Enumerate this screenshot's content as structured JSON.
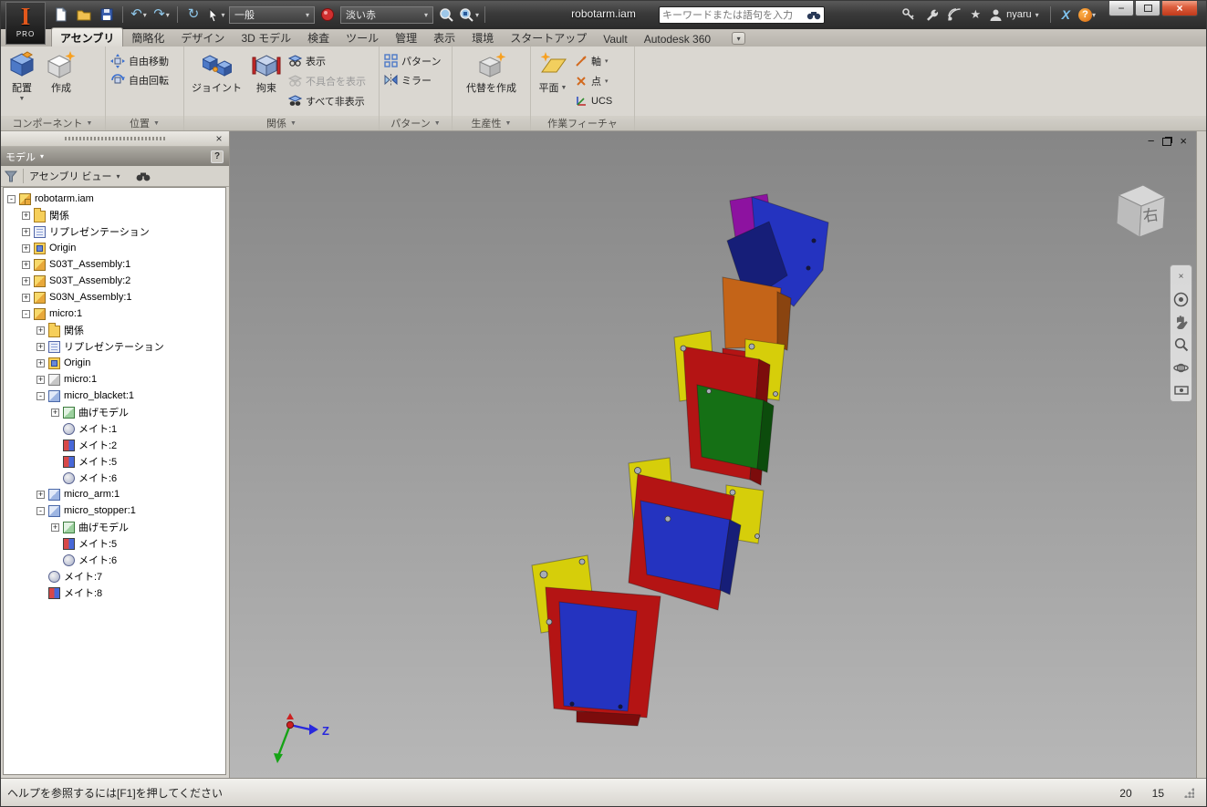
{
  "titlebar": {
    "app_initial": "I",
    "pro_label": "PRO",
    "doc_title": "robotarm.iam",
    "material_style": "一般",
    "appearance_style": "淡い赤",
    "search_placeholder": "キーワードまたは語句を入力",
    "username": "nyaru"
  },
  "icons": {
    "caret_down": "▼",
    "caret_small": "▾",
    "close": "×",
    "minimize": "−",
    "undo": "↶",
    "redo": "↷",
    "refresh": "↻",
    "star": "★",
    "question": "?",
    "x_logo": "X",
    "plus": "+",
    "minus": "-"
  },
  "ribbon": {
    "tabs": [
      "アセンブリ",
      "簡略化",
      "デザイン",
      "3D モデル",
      "検査",
      "ツール",
      "管理",
      "表示",
      "環境",
      "スタートアップ",
      "Vault",
      "Autodesk 360"
    ],
    "active_tab": "アセンブリ",
    "panels": {
      "component": {
        "title": "コンポーネント",
        "place": "配置",
        "create": "作成"
      },
      "position": {
        "title": "位置",
        "free_move": "自由移動",
        "free_rotate": "自由回転"
      },
      "relationships": {
        "title": "関係",
        "joint": "ジョイント",
        "constrain": "拘束",
        "show": "表示",
        "show_sick": "不具合を表示",
        "hide_all": "すべて非表示"
      },
      "pattern": {
        "title": "パターン",
        "pattern": "パターン",
        "mirror": "ミラー"
      },
      "productivity": {
        "title": "生産性",
        "create_substitutes": "代替を作成"
      },
      "work_features": {
        "title": "作業フィーチャ",
        "plane": "平面",
        "axis": "軸",
        "point": "点",
        "ucs": "UCS"
      }
    }
  },
  "browser": {
    "panel_title": "モデル",
    "view_selector": "アセンブリ ビュー",
    "help_glyph": "?",
    "tree": [
      {
        "label": "robotarm.iam",
        "level": 0,
        "expand": "-",
        "icon": "asmroot"
      },
      {
        "label": "関係",
        "level": 1,
        "expand": "+",
        "icon": "folder"
      },
      {
        "label": "リプレゼンテーション",
        "level": 1,
        "expand": "+",
        "icon": "repr"
      },
      {
        "label": "Origin",
        "level": 1,
        "expand": "+",
        "icon": "folder3d"
      },
      {
        "label": "S03T_Assembly:1",
        "level": 1,
        "expand": "+",
        "icon": "asm"
      },
      {
        "label": "S03T_Assembly:2",
        "level": 1,
        "expand": "+",
        "icon": "asm"
      },
      {
        "label": "S03N_Assembly:1",
        "level": 1,
        "expand": "+",
        "icon": "asm"
      },
      {
        "label": "micro:1",
        "level": 1,
        "expand": "-",
        "icon": "asm"
      },
      {
        "label": "関係",
        "level": 2,
        "expand": "+",
        "icon": "folder"
      },
      {
        "label": "リプレゼンテーション",
        "level": 2,
        "expand": "+",
        "icon": "repr"
      },
      {
        "label": "Origin",
        "level": 2,
        "expand": "+",
        "icon": "folder3d"
      },
      {
        "label": "micro:1",
        "level": 2,
        "expand": "+",
        "icon": "part"
      },
      {
        "label": "micro_blacket:1",
        "level": 2,
        "expand": "-",
        "icon": "sheet"
      },
      {
        "label": "曲げモデル",
        "level": 3,
        "expand": "+",
        "icon": "bend"
      },
      {
        "label": "メイト:1",
        "level": 3,
        "expand": null,
        "icon": "mate"
      },
      {
        "label": "メイト:2",
        "level": 3,
        "expand": null,
        "icon": "flush"
      },
      {
        "label": "メイト:5",
        "level": 3,
        "expand": null,
        "icon": "flush"
      },
      {
        "label": "メイト:6",
        "level": 3,
        "expand": null,
        "icon": "mate"
      },
      {
        "label": "micro_arm:1",
        "level": 2,
        "expand": "+",
        "icon": "sheet"
      },
      {
        "label": "micro_stopper:1",
        "level": 2,
        "expand": "-",
        "icon": "sheet"
      },
      {
        "label": "曲げモデル",
        "level": 3,
        "expand": "+",
        "icon": "bend"
      },
      {
        "label": "メイト:5",
        "level": 3,
        "expand": null,
        "icon": "flush"
      },
      {
        "label": "メイト:6",
        "level": 3,
        "expand": null,
        "icon": "mate"
      },
      {
        "label": "メイト:7",
        "level": 2,
        "expand": null,
        "icon": "mate"
      },
      {
        "label": "メイト:8",
        "level": 2,
        "expand": null,
        "icon": "flush"
      }
    ]
  },
  "viewport": {
    "viewcube_label": "右",
    "axis_z_label": "Z"
  },
  "statusbar": {
    "help_text": "ヘルプを参照するには[F1]を押してください",
    "value1": "20",
    "value2": "15"
  },
  "colors": {
    "part_red": "#b41414",
    "part_red_dark": "#7c0c0c",
    "part_blue": "#2433c0",
    "part_blue_dark": "#161e78",
    "part_yellow": "#d6ce0a",
    "part_green": "#157015",
    "part_green_dark": "#0c4c0c",
    "part_orange": "#c46418",
    "part_orange_dark": "#8a4410",
    "part_purple": "#8d12a0",
    "screw_gray": "#a7adb5",
    "pin_dark": "#15163c"
  }
}
